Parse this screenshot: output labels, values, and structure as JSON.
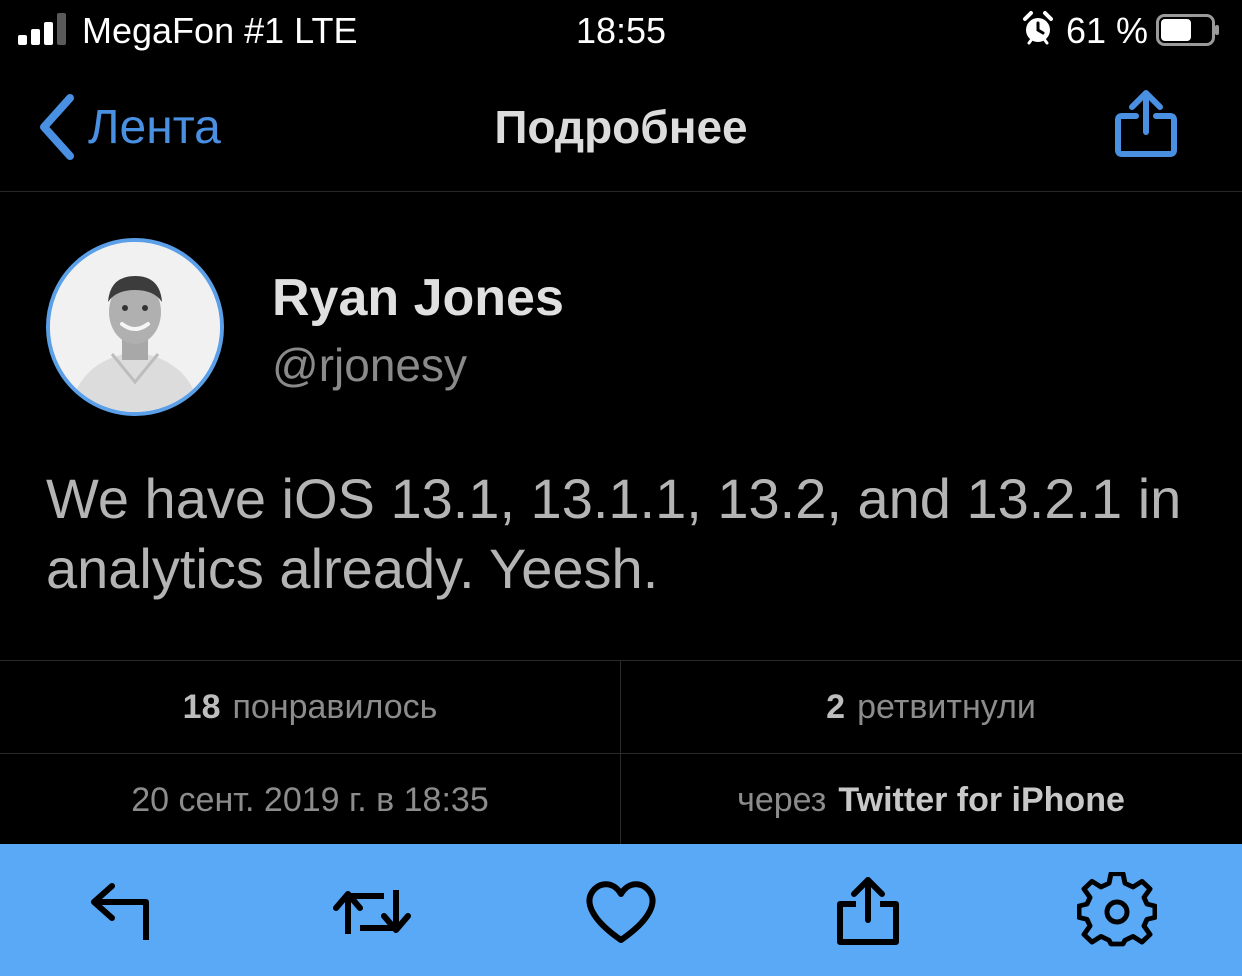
{
  "status_bar": {
    "carrier": "MegaFon #1 LTE",
    "time": "18:55",
    "battery_percent": "61 %",
    "signal_bars_filled": 3,
    "signal_bars_total": 4,
    "battery_level": 0.61,
    "alarm_icon": "alarm-clock-icon"
  },
  "nav": {
    "back_label": "Лента",
    "title": "Подробнее",
    "share_icon": "share-icon"
  },
  "tweet": {
    "display_name": "Ryan Jones",
    "handle": "@rjonesy",
    "text": "We have iOS 13.1, 13.1.1, 13.2, and 13.2.1 in analytics already. Yeesh.",
    "likes_count": "18",
    "likes_label": "понравилось",
    "retweets_count": "2",
    "retweets_label": "ретвитнули",
    "timestamp": "20 сент. 2019 г. в 18:35",
    "via_label": "через",
    "source": "Twitter for iPhone"
  },
  "toolbar": {
    "icons": [
      "reply-icon",
      "retweet-icon",
      "heart-icon",
      "share-icon",
      "gear-icon"
    ]
  },
  "colors": {
    "accent": "#4a90e2",
    "toolbar_bg": "#5aa9f7",
    "background": "#000000"
  }
}
